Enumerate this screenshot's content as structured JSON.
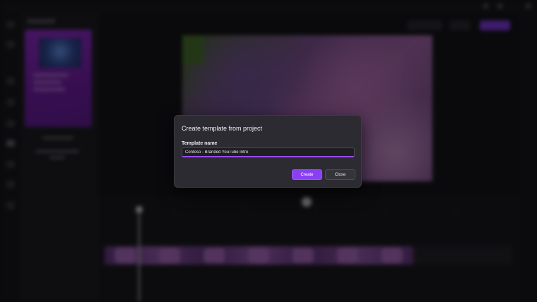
{
  "dialog": {
    "title": "Create template from project",
    "field_label": "Template name",
    "template_name_value": "Contoso - Branded YouTube Intro",
    "create_label": "Create",
    "close_label": "Close"
  },
  "colors": {
    "accent": "#8b3ff2",
    "dialog_bg": "#2b2b31",
    "input_focus_border": "#9a4cff"
  }
}
